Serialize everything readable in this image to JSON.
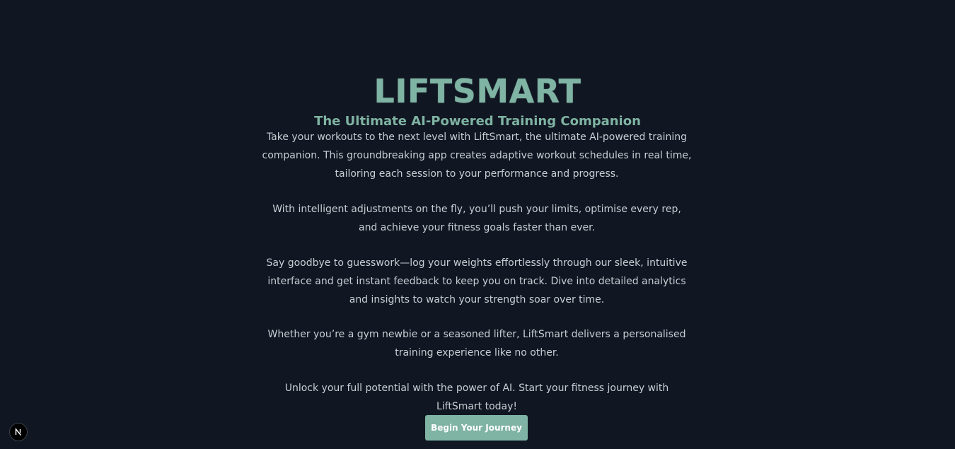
{
  "hero": {
    "logo": "LIFTSMART",
    "subtitle": "The Ultimate AI-Powered Training Companion",
    "paragraphs": [
      "Take your workouts to the next level with LiftSmart, the ultimate AI-powered training companion. This groundbreaking app creates adaptive workout schedules in real time, tailoring each session to your performance and progress.",
      "With intelligent adjustments on the fly, you’ll push your limits, optimise every rep, and achieve your fitness goals faster than ever.",
      "Say goodbye to guesswork—log your weights effortlessly through our sleek, intuitive interface and get instant feedback to keep you on track. Dive into detailed analytics and insights to watch your strength soar over time.",
      "Whether you’re a gym newbie or a seasoned lifter, LiftSmart delivers a personalised training experience like no other.",
      "Unlock your full potential with the power of AI. Start your fitness journey with LiftSmart today!"
    ],
    "cta_label": "Begin Your Journey"
  },
  "dev_indicator": {
    "icon": "nextjs-logo-icon"
  },
  "colors": {
    "background": "#111722",
    "accent": "#7fb3a3",
    "body_text": "#c8cdd4"
  }
}
